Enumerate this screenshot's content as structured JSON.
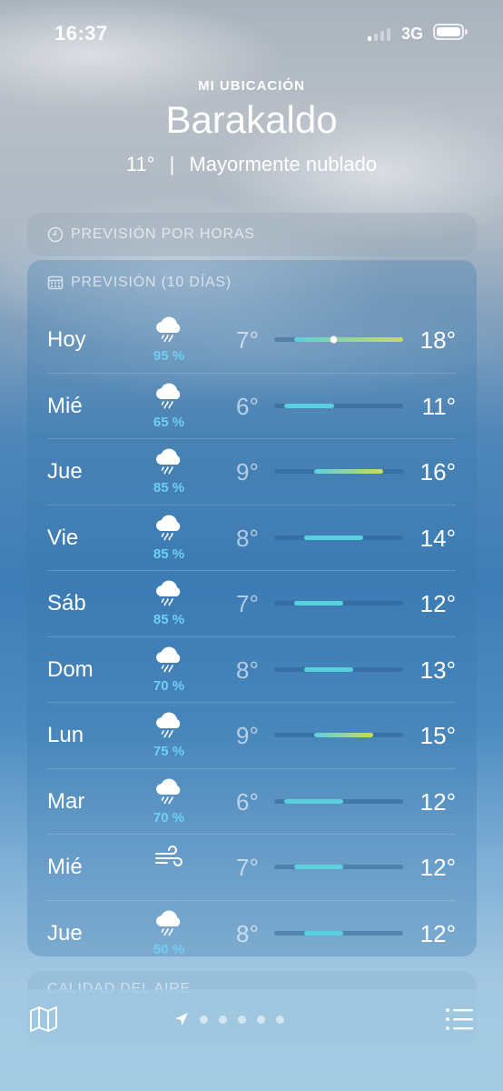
{
  "status_bar": {
    "time": "16:37",
    "network": "3G"
  },
  "header": {
    "location_label": "MI UBICACIÓN",
    "city": "Barakaldo",
    "temperature": "11°",
    "separator": "|",
    "condition": "Mayormente nublado"
  },
  "hourly": {
    "title": "PREVISIÓN POR HORAS"
  },
  "forecast": {
    "title": "PREVISIÓN (10 DÍAS)",
    "scale": {
      "min": 5,
      "max": 18
    },
    "days": [
      {
        "day": "Hoy",
        "icon": "cloud-rain-icon",
        "precip": "95 %",
        "low": "7°",
        "high": "18°",
        "lo_val": 7,
        "hi_val": 18,
        "current": 11
      },
      {
        "day": "Mié",
        "icon": "cloud-rain-icon",
        "precip": "65 %",
        "low": "6°",
        "high": "11°",
        "lo_val": 6,
        "hi_val": 11
      },
      {
        "day": "Jue",
        "icon": "cloud-rain-icon",
        "precip": "85 %",
        "low": "9°",
        "high": "16°",
        "lo_val": 9,
        "hi_val": 16
      },
      {
        "day": "Vie",
        "icon": "cloud-rain-icon",
        "precip": "85 %",
        "low": "8°",
        "high": "14°",
        "lo_val": 8,
        "hi_val": 14
      },
      {
        "day": "Sáb",
        "icon": "cloud-rain-icon",
        "precip": "85 %",
        "low": "7°",
        "high": "12°",
        "lo_val": 7,
        "hi_val": 12
      },
      {
        "day": "Dom",
        "icon": "cloud-rain-icon",
        "precip": "70 %",
        "low": "8°",
        "high": "13°",
        "lo_val": 8,
        "hi_val": 13
      },
      {
        "day": "Lun",
        "icon": "cloud-rain-icon",
        "precip": "75 %",
        "low": "9°",
        "high": "15°",
        "lo_val": 9,
        "hi_val": 15
      },
      {
        "day": "Mar",
        "icon": "cloud-rain-icon",
        "precip": "70 %",
        "low": "6°",
        "high": "12°",
        "lo_val": 6,
        "hi_val": 12
      },
      {
        "day": "Mié",
        "icon": "wind-icon",
        "precip": "",
        "low": "7°",
        "high": "12°",
        "lo_val": 7,
        "hi_val": 12
      },
      {
        "day": "Jue",
        "icon": "cloud-rain-icon",
        "precip": "50 %",
        "low": "8°",
        "high": "12°",
        "lo_val": 8,
        "hi_val": 12
      }
    ]
  },
  "air_quality": {
    "title": "CALIDAD DEL AIRE"
  },
  "tab_bar": {
    "pages": 6,
    "active_page": 0
  },
  "colors": {
    "precip": "#6ed0f5",
    "bar_cool": "#5ad0de",
    "bar_warm": "#c8dc5a"
  }
}
